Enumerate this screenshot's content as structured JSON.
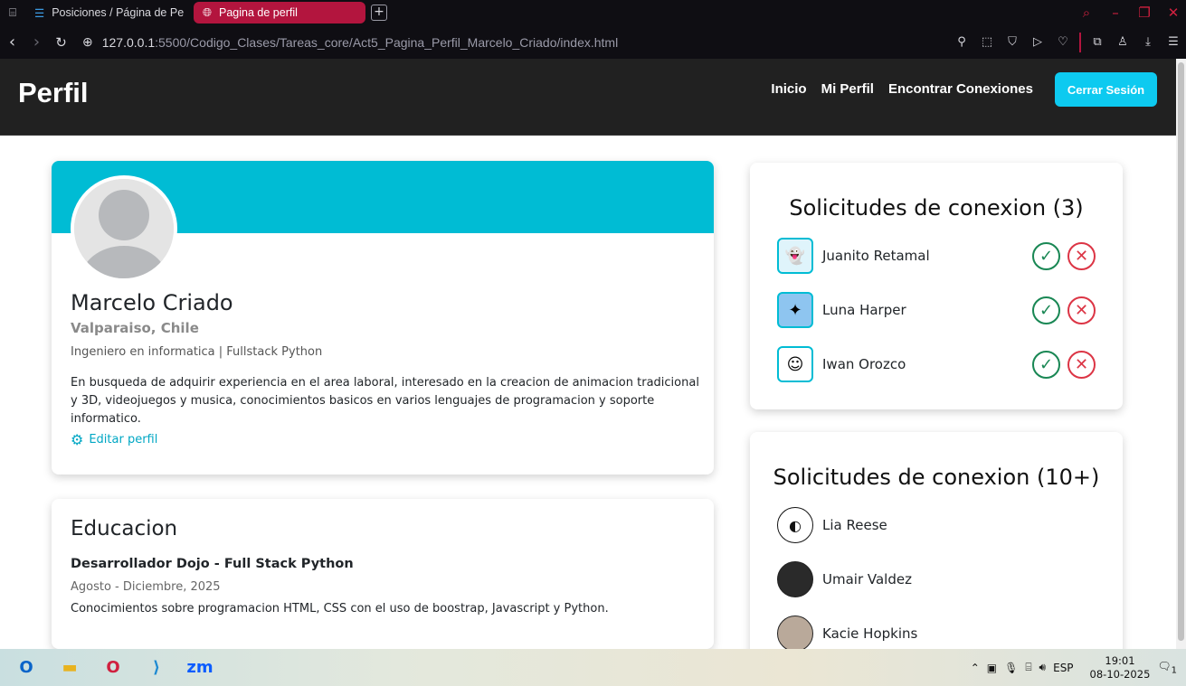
{
  "browser": {
    "tabs": [
      {
        "label": "Posiciones / Página de Pe"
      },
      {
        "label": "Pagina de perfil"
      }
    ],
    "url": {
      "host": "127.0.0.1",
      "rest": ":5500/Codigo_Clases/Tareas_core/Act5_Pagina_Perfil_Marcelo_Criado/index.html"
    }
  },
  "site": {
    "brand": "Perfil",
    "nav": [
      "Inicio",
      "Mi Perfil",
      "Encontrar Conexiones"
    ],
    "logout": "Cerrar Sesión"
  },
  "profile": {
    "name": "Marcelo Criado",
    "location": "Valparaiso, Chile",
    "job": "Ingeniero en informatica | Fullstack Python",
    "description": "En busqueda de adquirir experiencia en el area laboral, interesado en la creacion de animacion tradicional y 3D, videojuegos y musica, conocimientos basicos en varios lenguajes de programacion y soporte informatico.",
    "edit": "Editar perfil"
  },
  "education": {
    "heading": "Educacion",
    "title": "Desarrollador Dojo - Full Stack Python",
    "dates": "Agosto - Diciembre, 2025",
    "text": "Conocimientos sobre programacion HTML, CSS con el uso de boostrap, Javascript y Python."
  },
  "requests": {
    "heading": "Solicitudes de conexion (3)",
    "items": [
      {
        "name": "Juanito Retamal"
      },
      {
        "name": "Luna Harper"
      },
      {
        "name": "Iwan Orozco"
      }
    ]
  },
  "connections": {
    "heading": "Solicitudes de conexion (10+)",
    "items": [
      {
        "name": "Lia Reese"
      },
      {
        "name": "Umair Valdez"
      },
      {
        "name": "Kacie Hopkins"
      }
    ]
  },
  "taskbar": {
    "lang": "ESP",
    "time": "19:01",
    "date": "08-10-2025",
    "notif": "1"
  }
}
